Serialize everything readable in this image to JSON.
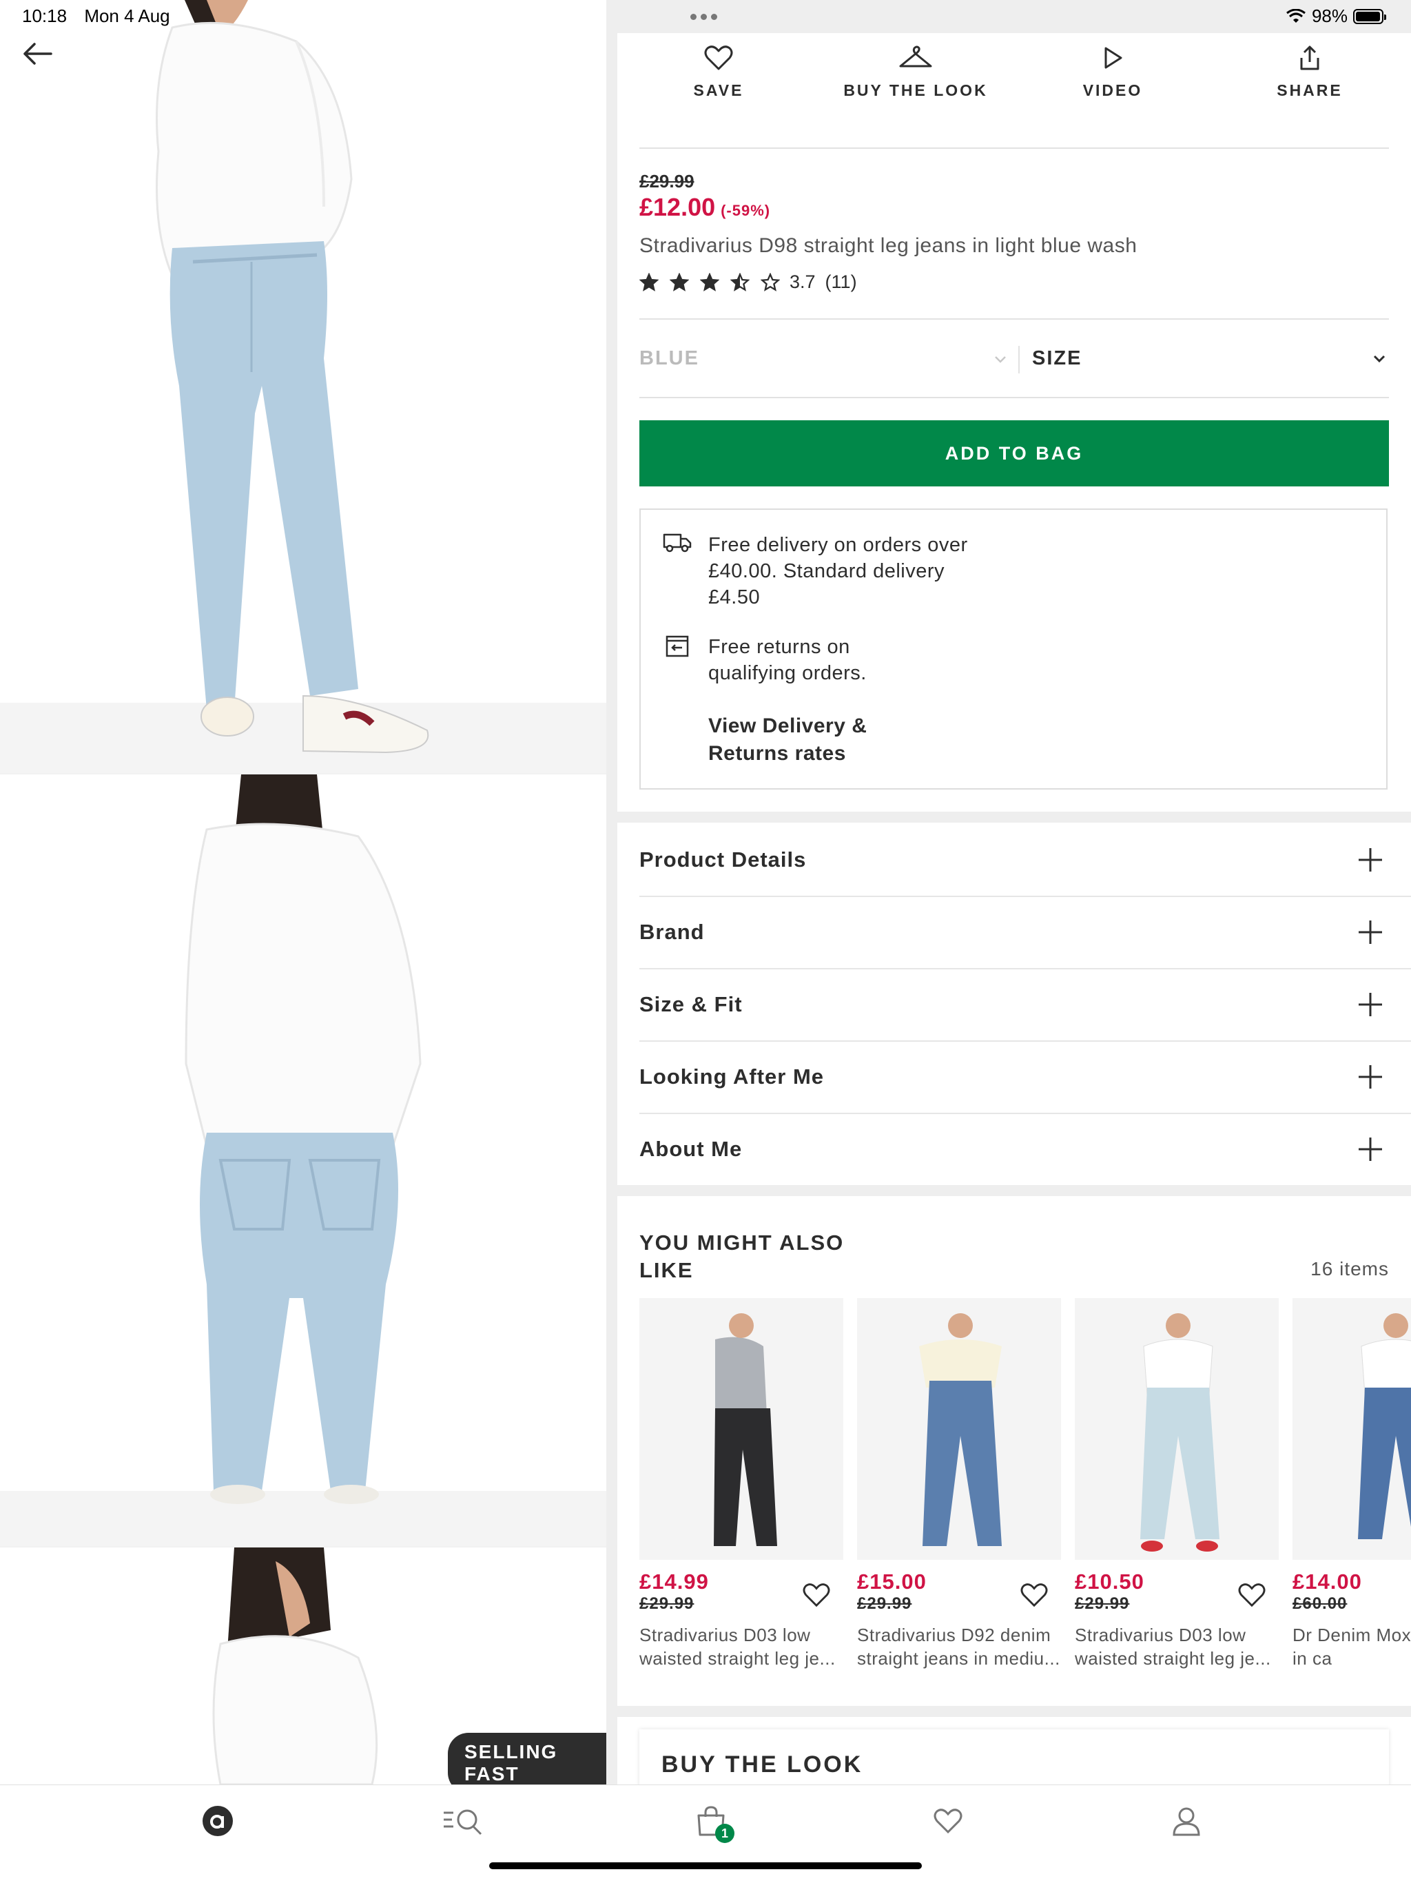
{
  "status_bar": {
    "time": "10:18",
    "date": "Mon 4 Aug",
    "battery": "98%",
    "battery_level": 0.98
  },
  "actions": [
    {
      "label": "SAVE",
      "icon": "heart-icon"
    },
    {
      "label": "BUY THE LOOK",
      "icon": "hanger-icon"
    },
    {
      "label": "VIDEO",
      "icon": "play-icon"
    },
    {
      "label": "SHARE",
      "icon": "share-icon"
    }
  ],
  "product": {
    "was_price": "£29.99",
    "price": "£12.00",
    "discount": "(-59%)",
    "name": "Stradivarius D98 straight leg jeans in light blue wash",
    "rating": "3.7",
    "rating_value": 3.7,
    "review_count": "(11)",
    "colour": "BLUE",
    "size_label": "SIZE",
    "selling_fast": "SELLING FAST"
  },
  "add_to_bag": "ADD TO BAG",
  "delivery": {
    "shipping": "Free delivery on orders over £40.00. Standard delivery £4.50",
    "returns": "Free returns on qualifying orders.",
    "link": "View Delivery & Returns rates"
  },
  "accordion": [
    "Product Details",
    "Brand",
    "Size & Fit",
    "Looking After Me",
    "About Me"
  ],
  "you_might_like": {
    "title": "YOU MIGHT ALSO LIKE",
    "count": "16 items",
    "items": [
      {
        "price": "£14.99",
        "was": "£29.99",
        "name": "Stradivarius D03 low waisted straight leg je..."
      },
      {
        "price": "£15.00",
        "was": "£29.99",
        "name": "Stradivarius D92 denim straight jeans in mediu..."
      },
      {
        "price": "£10.50",
        "was": "£29.99",
        "name": "Stradivarius D03 low waisted straight leg je..."
      },
      {
        "price": "£14.00",
        "was": "£60.00",
        "name": "Dr Denim Mox leg jeans in ca"
      }
    ]
  },
  "buy_the_look": "BUY THE LOOK",
  "nav": {
    "bag_count": "1"
  },
  "colors": {
    "sale_red": "#d01345",
    "cta_green": "#018849",
    "text": "#2d2d2d"
  }
}
